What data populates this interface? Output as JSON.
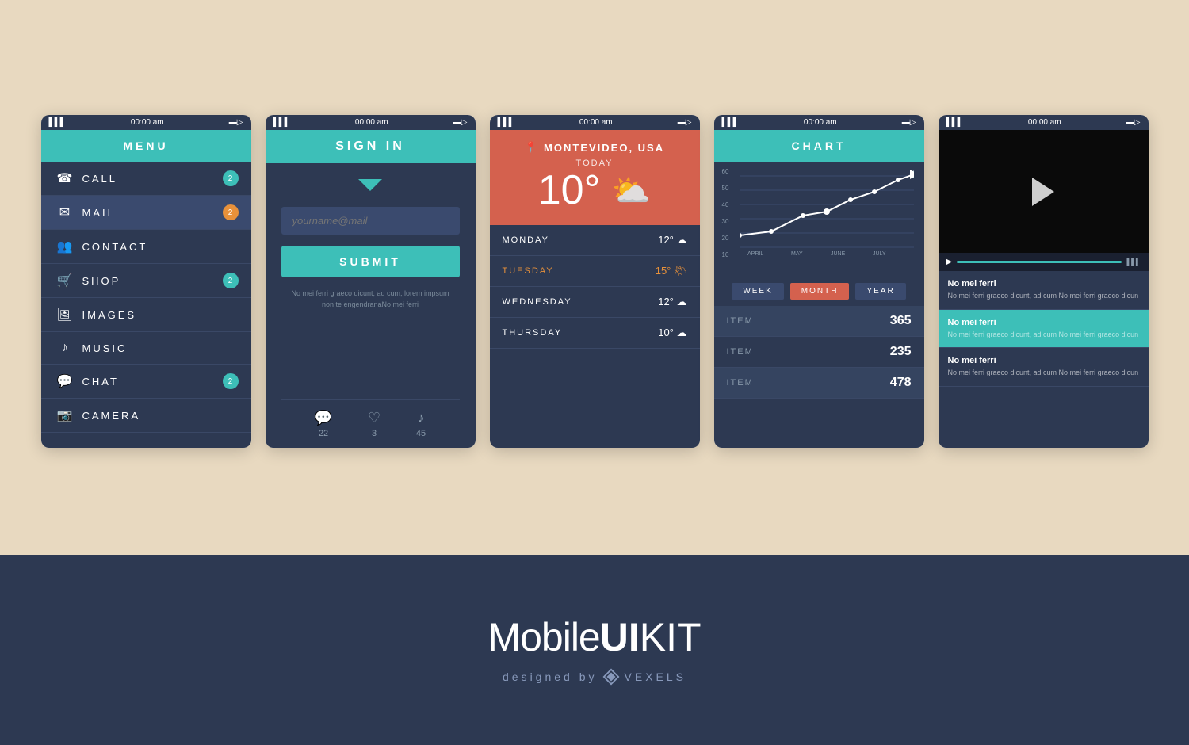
{
  "phones": {
    "statusBar": {
      "signal": "▌▌▌",
      "time": "00:00 am",
      "battery": "▬"
    }
  },
  "phone1": {
    "header": "MENU",
    "items": [
      {
        "label": "CALL",
        "icon": "📞",
        "badge": "2",
        "badgeType": "teal",
        "active": false
      },
      {
        "label": "MAIL",
        "icon": "✉",
        "badge": "2",
        "badgeType": "orange",
        "active": true
      },
      {
        "label": "CONTACT",
        "icon": "👥",
        "badge": "",
        "badgeType": "",
        "active": false
      },
      {
        "label": "SHOP",
        "icon": "🛒",
        "badge": "2",
        "badgeType": "teal",
        "active": false
      },
      {
        "label": "IMAGES",
        "icon": "🖼",
        "badge": "",
        "badgeType": "",
        "active": false
      },
      {
        "label": "MUSIC",
        "icon": "🎵",
        "badge": "",
        "badgeType": "",
        "active": false
      },
      {
        "label": "CHAT",
        "icon": "💬",
        "badge": "2",
        "badgeType": "teal",
        "active": false
      },
      {
        "label": "CAMERA",
        "icon": "📷",
        "badge": "",
        "badgeType": "",
        "active": false
      }
    ]
  },
  "phone2": {
    "header": "SIGN IN",
    "emailPlaceholder": "yourname@mail",
    "submitLabel": "SUBMIT",
    "loremText": "No mei ferri graeco dicunt, ad cum, lorem impsum non te engendranaNo mei ferri",
    "footer": [
      {
        "icon": "💬",
        "count": "22"
      },
      {
        "icon": "♡",
        "count": "3"
      },
      {
        "icon": "♪",
        "count": "45"
      }
    ]
  },
  "phone3": {
    "location": "MONTEVIDEO, USA",
    "todayLabel": "TODAY",
    "temperature": "10°",
    "days": [
      {
        "day": "MONDAY",
        "temp": "12°",
        "icon": "☁",
        "active": false
      },
      {
        "day": "TUESDAY",
        "temp": "15°",
        "icon": "🌤",
        "active": true
      },
      {
        "day": "WEDNESDAY",
        "temp": "12°",
        "icon": "☁",
        "active": false
      },
      {
        "day": "THURSDAY",
        "temp": "10°",
        "icon": "☁",
        "active": false
      }
    ]
  },
  "phone4": {
    "header": "CHART",
    "tabs": [
      "WEEK",
      "MONTH",
      "YEAR"
    ],
    "activeTab": "MONTH",
    "yLabels": [
      "60",
      "50",
      "40",
      "30",
      "20",
      "10"
    ],
    "xLabels": [
      "APRIL",
      "MAY",
      "JUNE",
      "JULY"
    ],
    "items": [
      {
        "label": "ITEM",
        "value": "365"
      },
      {
        "label": "ITEM",
        "value": "235"
      },
      {
        "label": "ITEM",
        "value": "478"
      }
    ]
  },
  "phone5": {
    "videoItems": [
      {
        "title": "No mei ferri",
        "desc": "No mei ferri graeco dicunt, ad cum No mei ferri graeco dicun"
      },
      {
        "title": "No mei ferri",
        "desc": "No mei ferri graeco dicunt, ad cum No mei ferri graeco dicun"
      },
      {
        "title": "No mei ferri",
        "desc": "No mei ferri graeco dicunt, ad cum No mei ferri graeco dicun"
      }
    ]
  },
  "branding": {
    "mobile": "Mobile",
    "ui": "UI",
    "kit": "KIT",
    "designed_by": "designed by",
    "vexels": "vexels"
  }
}
